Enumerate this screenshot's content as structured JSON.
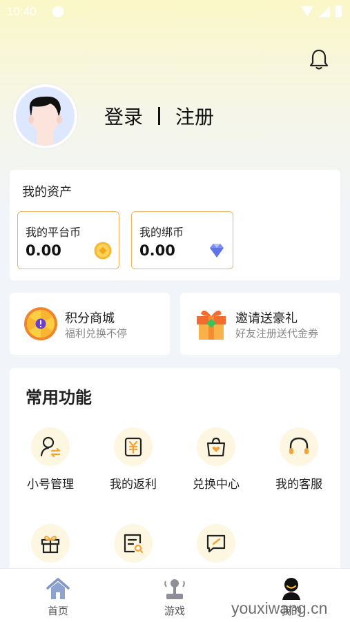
{
  "status_bar": {
    "time": "10:40"
  },
  "header": {
    "login": "登录",
    "register": "注册"
  },
  "assets": {
    "title": "我的资产",
    "platform_coin": {
      "label": "我的平台币",
      "value": "0.00"
    },
    "bound_coin": {
      "label": "我的绑币",
      "value": "0.00"
    }
  },
  "promos": [
    {
      "title": "积分商城",
      "subtitle": "福利兑换不停"
    },
    {
      "title": "邀请送豪礼",
      "subtitle": "好友注册送代金券"
    }
  ],
  "functions": {
    "title": "常用功能",
    "items": [
      {
        "label": "小号管理",
        "icon": "account-switch-icon"
      },
      {
        "label": "我的返利",
        "icon": "rebate-icon"
      },
      {
        "label": "兑换中心",
        "icon": "exchange-bag-icon"
      },
      {
        "label": "我的客服",
        "icon": "headset-icon"
      },
      {
        "label": "",
        "icon": "gift-icon"
      },
      {
        "label": "",
        "icon": "search-document-icon"
      },
      {
        "label": "",
        "icon": "feedback-icon"
      }
    ]
  },
  "tabbar": {
    "items": [
      {
        "label": "首页",
        "icon": "home-icon"
      },
      {
        "label": "游戏",
        "icon": "joystick-icon"
      },
      {
        "label": "我的",
        "icon": "profile-icon",
        "active": true
      }
    ]
  },
  "watermark": "youxiwang.cn",
  "colors": {
    "accent": "#f2b35a",
    "tab_active": "#7f97c8",
    "icon_bg": "#fdf7e2"
  }
}
